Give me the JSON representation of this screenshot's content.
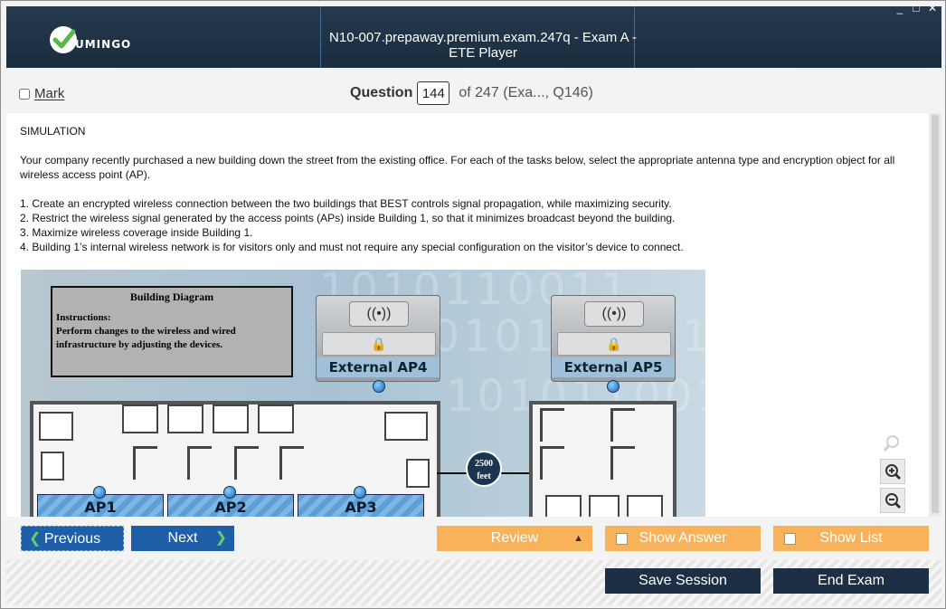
{
  "window": {
    "title": "N10-007.prepaway.premium.exam.247q - Exam A - ETE Player",
    "logo_text": "UMINGO",
    "controls": {
      "minimize": "_",
      "maximize": "□",
      "close": "✕"
    }
  },
  "question_bar": {
    "mark_label": "Mark",
    "question_label": "Question",
    "question_number": "144",
    "of_text": "of 247 (Exa..., Q146)"
  },
  "question": {
    "type_label": "SIMULATION",
    "intro": "Your company recently purchased a new building down the street from the existing office. For each of the tasks below, select the appropriate antenna type and encryption object for all wireless access point (AP).",
    "tasks": [
      "1. Create an encrypted wireless connection between the two buildings that BEST controls signal propagation, while maximizing security.",
      "2. Restrict the wireless signal generated by the access points (APs) inside Building 1, so that it minimizes broadcast beyond the building.",
      "3. Maximize wireless coverage inside Building 1.",
      "4. Building 1’s internal wireless network is for visitors only and must not require any special configuration on the visitor’s device to connect."
    ]
  },
  "diagram": {
    "title": "Building Diagram",
    "instructions_label": "Instructions:",
    "instructions_text": "Perform changes to the wireless and wired infrastructure by adjusting the devices.",
    "external_aps": [
      "External AP4",
      "External AP5"
    ],
    "internal_aps": [
      "AP1",
      "AP2",
      "AP3"
    ],
    "distance_value": "2500",
    "distance_unit": "feet",
    "background_digits": "1010110011"
  },
  "zoom": {
    "icons": [
      "search-icon",
      "zoom-in-icon",
      "zoom-out-icon"
    ]
  },
  "nav": {
    "previous_label": "Previous",
    "next_label": "Next",
    "review_label": "Review",
    "show_answer_label": "Show Answer",
    "show_list_label": "Show List"
  },
  "footer": {
    "save_label": "Save Session",
    "end_label": "End Exam"
  },
  "colors": {
    "title_bar": "#1f3346",
    "nav_blue": "#1f5fa8",
    "orange": "#f8b25a",
    "dark_button": "#1c2f44"
  }
}
